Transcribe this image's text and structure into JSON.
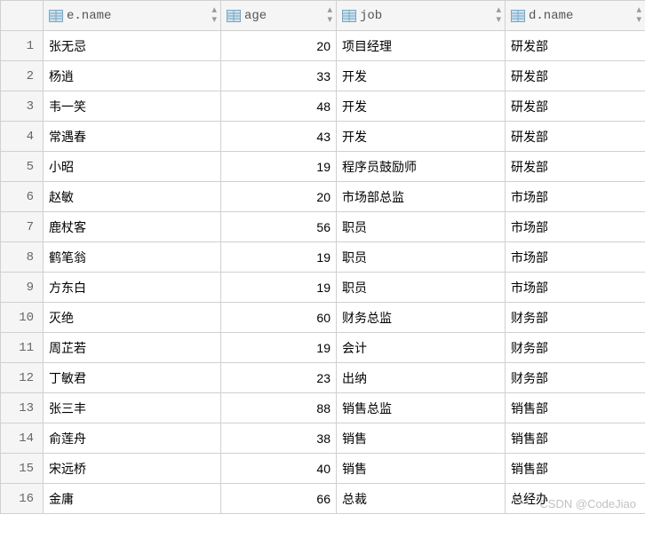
{
  "columns": [
    {
      "key": "ename",
      "label": "e.name",
      "icon": "column-icon"
    },
    {
      "key": "age",
      "label": "age",
      "icon": "column-icon"
    },
    {
      "key": "job",
      "label": "job",
      "icon": "column-icon"
    },
    {
      "key": "dname",
      "label": "d.name",
      "icon": "column-icon"
    }
  ],
  "rows": [
    {
      "n": "1",
      "ename": "张无忌",
      "age": "20",
      "job": "项目经理",
      "dname": "研发部"
    },
    {
      "n": "2",
      "ename": "杨逍",
      "age": "33",
      "job": "开发",
      "dname": "研发部"
    },
    {
      "n": "3",
      "ename": "韦一笑",
      "age": "48",
      "job": "开发",
      "dname": "研发部"
    },
    {
      "n": "4",
      "ename": "常遇春",
      "age": "43",
      "job": "开发",
      "dname": "研发部"
    },
    {
      "n": "5",
      "ename": "小昭",
      "age": "19",
      "job": "程序员鼓励师",
      "dname": "研发部"
    },
    {
      "n": "6",
      "ename": "赵敏",
      "age": "20",
      "job": "市场部总监",
      "dname": "市场部"
    },
    {
      "n": "7",
      "ename": "鹿杖客",
      "age": "56",
      "job": "职员",
      "dname": "市场部"
    },
    {
      "n": "8",
      "ename": "鹤笔翁",
      "age": "19",
      "job": "职员",
      "dname": "市场部"
    },
    {
      "n": "9",
      "ename": "方东白",
      "age": "19",
      "job": "职员",
      "dname": "市场部"
    },
    {
      "n": "10",
      "ename": "灭绝",
      "age": "60",
      "job": "财务总监",
      "dname": "财务部"
    },
    {
      "n": "11",
      "ename": "周芷若",
      "age": "19",
      "job": "会计",
      "dname": "财务部"
    },
    {
      "n": "12",
      "ename": "丁敏君",
      "age": "23",
      "job": "出纳",
      "dname": "财务部"
    },
    {
      "n": "13",
      "ename": "张三丰",
      "age": "88",
      "job": "销售总监",
      "dname": "销售部"
    },
    {
      "n": "14",
      "ename": "俞莲舟",
      "age": "38",
      "job": "销售",
      "dname": "销售部"
    },
    {
      "n": "15",
      "ename": "宋远桥",
      "age": "40",
      "job": "销售",
      "dname": "销售部"
    },
    {
      "n": "16",
      "ename": "金庸",
      "age": "66",
      "job": "总裁",
      "dname": "总经办"
    }
  ],
  "watermark": "CSDN @CodeJiao"
}
